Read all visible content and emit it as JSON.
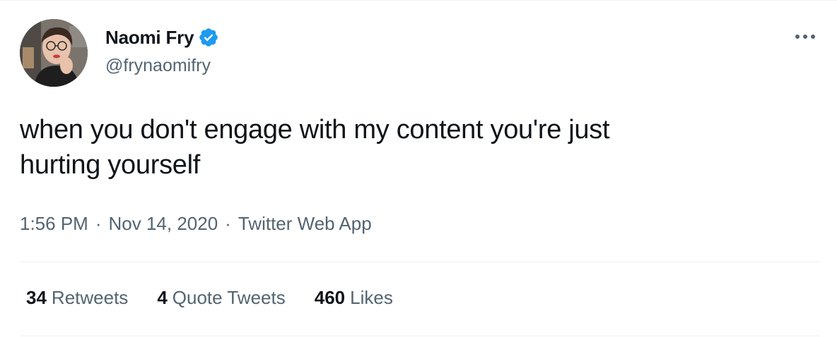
{
  "tweet": {
    "author": {
      "name": "Naomi Fry",
      "handle": "@frynaomifry",
      "verified": true,
      "avatar_icon": "avatar-photo"
    },
    "text_lines": [
      "when you don't engage with my content you're just",
      "hurting yourself"
    ],
    "meta": {
      "time": "1:56 PM",
      "separator": "·",
      "date": "Nov 14, 2020",
      "source": "Twitter Web App"
    },
    "stats": [
      {
        "count": "34",
        "label": "Retweets"
      },
      {
        "count": "4",
        "label": "Quote Tweets"
      },
      {
        "count": "460",
        "label": "Likes"
      }
    ],
    "more_icon": "more-horizontal-icon"
  },
  "colors": {
    "text_primary": "#0f1419",
    "text_secondary": "#536471",
    "verified_blue": "#1d9bf0",
    "divider": "#eff3f4"
  }
}
